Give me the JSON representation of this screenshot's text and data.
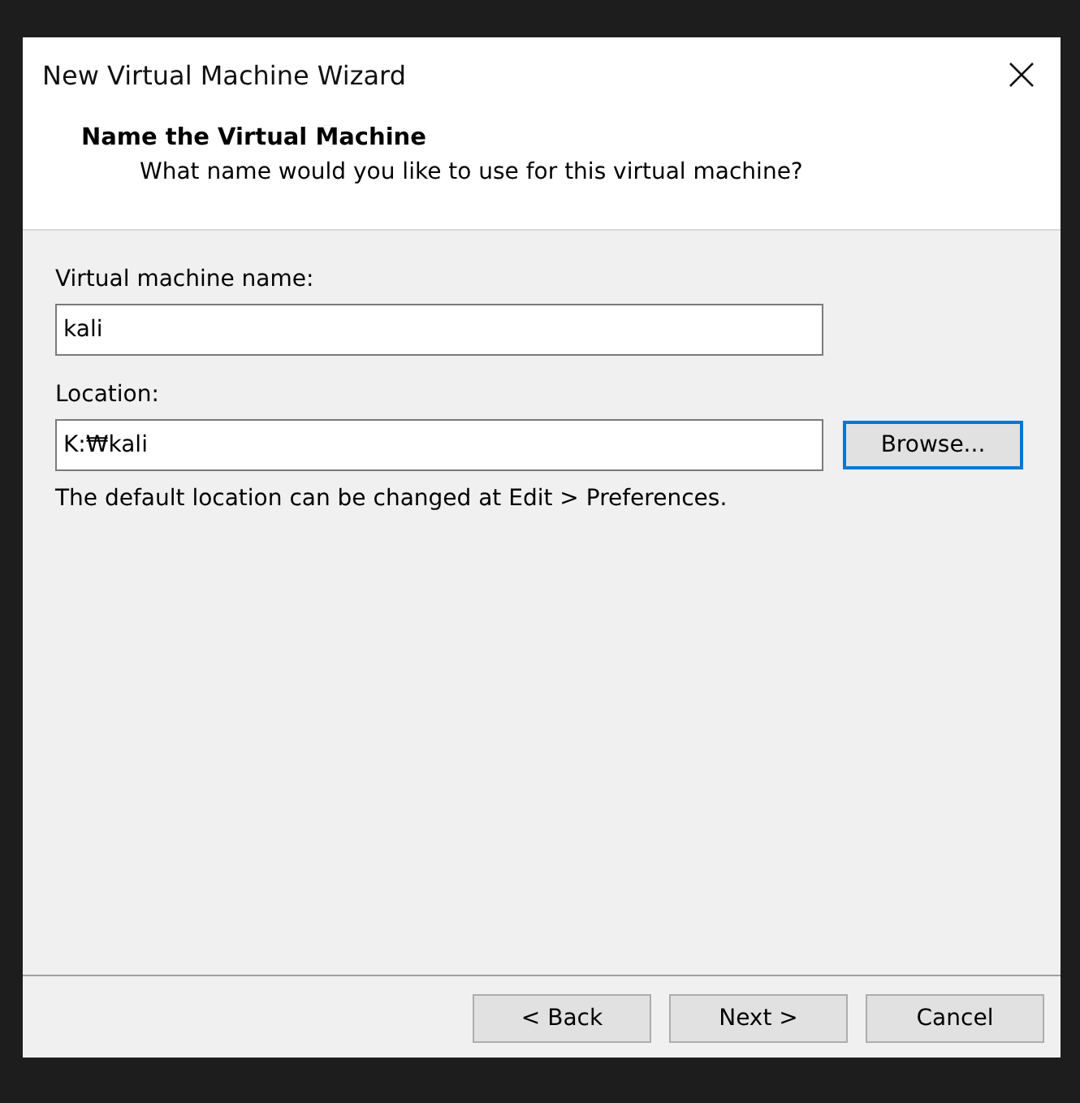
{
  "window": {
    "title": "New Virtual Machine Wizard"
  },
  "header": {
    "title": "Name the Virtual Machine",
    "subtitle": "What name would you like to use for this virtual machine?"
  },
  "fields": [
    {
      "label": "Virtual machine name:",
      "value": "kali"
    },
    {
      "label": "Location:",
      "value": "K:₩kali",
      "button": {
        "label": "Browse...",
        "focused": true
      }
    }
  ],
  "hint": "The default location can be changed at Edit > Preferences.",
  "buttons": [
    {
      "label": "< Back"
    },
    {
      "label": "Next >"
    },
    {
      "label": "Cancel"
    }
  ]
}
